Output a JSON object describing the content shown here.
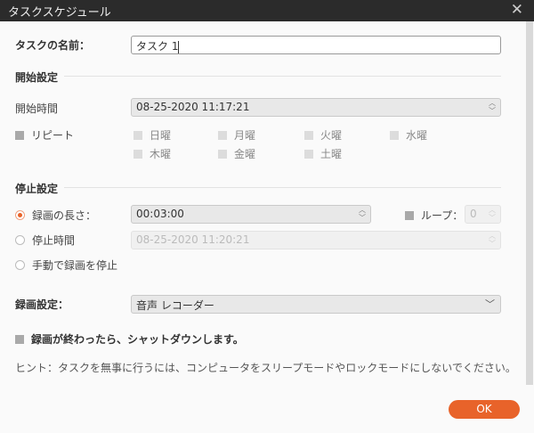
{
  "window": {
    "title": "タスクスケジュール",
    "close_icon": "close-icon"
  },
  "task_name": {
    "label": "タスクの名前：",
    "value": "タスク 1"
  },
  "start": {
    "section": "開始設定",
    "time_label": "開始時間",
    "time_value": "08-25-2020 11:17:21",
    "repeat_label": "リピート",
    "days": [
      "日曜",
      "月曜",
      "火曜",
      "水曜",
      "木曜",
      "金曜",
      "土曜"
    ]
  },
  "stop": {
    "section": "停止設定",
    "duration_label": "録画の長さ：",
    "duration_value": "00:03:00",
    "duration_selected": true,
    "loop_label": "ループ：",
    "loop_value": "0",
    "stop_time_label": "停止時間",
    "stop_time_value": "08-25-2020 11:20:21",
    "manual_label": "手動で録画を停止"
  },
  "recording": {
    "label": "録画設定：",
    "value": "音声 レコーダー"
  },
  "shutdown_label": "録画が終わったら、シャットダウンします。",
  "hint": "ヒント：タスクを無事に行うには、コンピュータをスリープモードやロックモードにしないでください。",
  "ok_label": "OK",
  "colors": {
    "accent": "#e8632a",
    "titlebar": "#2b2b2b"
  }
}
